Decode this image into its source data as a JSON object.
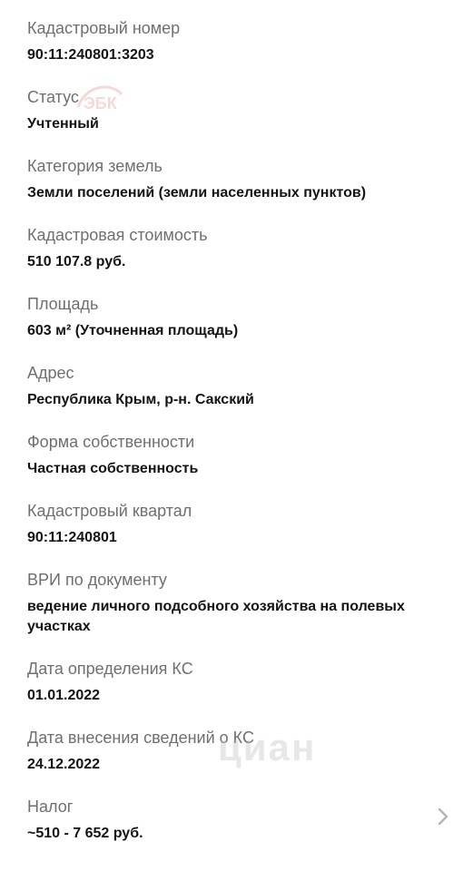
{
  "fields": [
    {
      "label": "Кадастровый номер",
      "value": "90:11:240801:3203"
    },
    {
      "label": "Статус",
      "value": "Учтенный"
    },
    {
      "label": "Категория земель",
      "value": "Земли поселений (земли населенных пунктов)"
    },
    {
      "label": "Кадастровая стоимость",
      "value": "510 107.8 руб."
    },
    {
      "label": "Площадь",
      "value": "603 м² (Уточненная площадь)"
    },
    {
      "label": "Адрес",
      "value": "Республика Крым, р-н. Сакский"
    },
    {
      "label": "Форма собственности",
      "value": "Частная собственность"
    },
    {
      "label": "Кадастровый квартал",
      "value": "90:11:240801"
    },
    {
      "label": "ВРИ по документу",
      "value": "ведение личного подсобного хозяйства на полевых участках"
    },
    {
      "label": "Дата определения КС",
      "value": "01.01.2022"
    },
    {
      "label": "Дата внесения сведений о КС",
      "value": "24.12.2022"
    },
    {
      "label": "Налог",
      "value": "~510 - 7 652 руб."
    }
  ],
  "watermark": {
    "logo_text": "ЭБК",
    "text": "циан"
  },
  "icons": {
    "chevron": "chevron-right-icon"
  },
  "colors": {
    "label": "#6f6f6f",
    "value": "#141414",
    "chevron": "#b5b5b5",
    "watermark_logo": "#d9534f"
  }
}
